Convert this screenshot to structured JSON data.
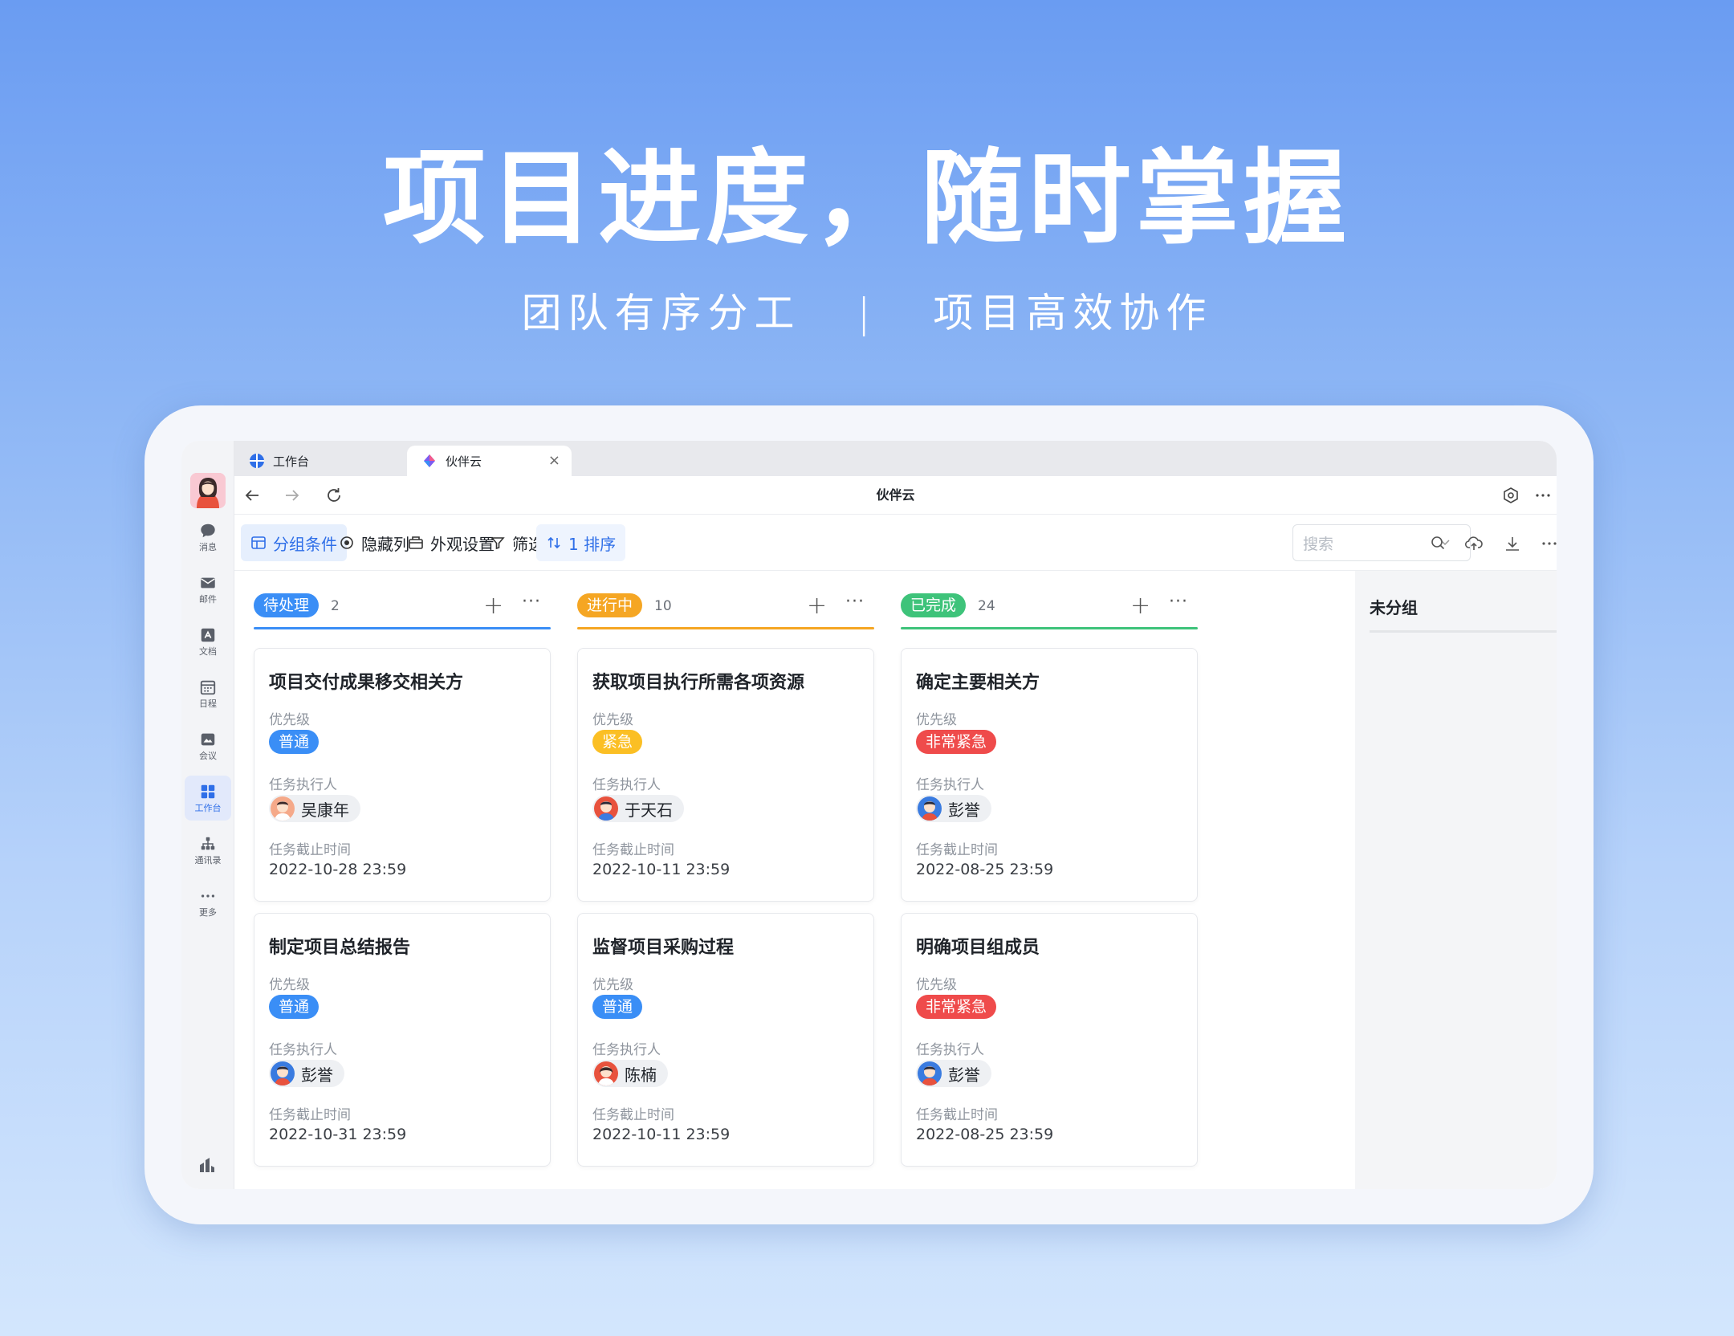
{
  "hero": {
    "title": "项目进度，随时掌握",
    "subtitle_left": "团队有序分工",
    "separator": "|",
    "subtitle_right": "项目高效协作"
  },
  "rail": {
    "items": [
      {
        "label": "消息",
        "icon": "chat-icon"
      },
      {
        "label": "邮件",
        "icon": "mail-icon"
      },
      {
        "label": "文档",
        "icon": "doc-icon"
      },
      {
        "label": "日程",
        "icon": "calendar-icon"
      },
      {
        "label": "会议",
        "icon": "meeting-icon"
      },
      {
        "label": "工作台",
        "icon": "workbench-icon",
        "active": true
      },
      {
        "label": "通讯录",
        "icon": "contacts-icon"
      },
      {
        "label": "更多",
        "icon": "more-icon"
      }
    ]
  },
  "tabs": [
    {
      "label": "工作台"
    },
    {
      "label": "伙伴云",
      "active": true
    }
  ],
  "nav": {
    "title": "伙伴云"
  },
  "toolbar": {
    "group": "分组条件",
    "hide": "隐藏列",
    "appearance": "外观设置",
    "filter": "筛选",
    "sort": "1 排序",
    "search_placeholder": "搜索"
  },
  "labels": {
    "priority": "优先级",
    "assignee": "任务执行人",
    "due": "任务截止时间",
    "plus": "+",
    "more": "···"
  },
  "colors": {
    "pending": "#3a8ef6",
    "in_progress": "#f5a623",
    "done": "#3ec37a",
    "priority_normal": "#3a8ef6",
    "priority_urgent": "#fbbf24",
    "priority_critical": "#ef4b4b"
  },
  "columns": [
    {
      "status": "待处理",
      "count": "2",
      "color": "#3a8ef6",
      "cards": [
        {
          "title": "项目交付成果移交相关方",
          "priority": "普通",
          "priority_color": "#3a8ef6",
          "assignee": "吴康年",
          "due": "2022-10-28 23:59"
        },
        {
          "title": "制定项目总结报告",
          "priority": "普通",
          "priority_color": "#3a8ef6",
          "assignee": "彭誉",
          "due": "2022-10-31 23:59"
        }
      ]
    },
    {
      "status": "进行中",
      "count": "10",
      "color": "#f5a623",
      "cards": [
        {
          "title": "获取项目执行所需各项资源",
          "priority": "紧急",
          "priority_color": "#fbbf24",
          "assignee": "于天石",
          "due": "2022-10-11 23:59"
        },
        {
          "title": "监督项目采购过程",
          "priority": "普通",
          "priority_color": "#3a8ef6",
          "assignee": "陈楠",
          "due": "2022-10-11 23:59"
        }
      ]
    },
    {
      "status": "已完成",
      "count": "24",
      "color": "#3ec37a",
      "cards": [
        {
          "title": "确定主要相关方",
          "priority": "非常紧急",
          "priority_color": "#ef4b4b",
          "assignee": "彭誉",
          "due": "2022-08-25 23:59"
        },
        {
          "title": "明确项目组成员",
          "priority": "非常紧急",
          "priority_color": "#ef4b4b",
          "assignee": "彭誉",
          "due": "2022-08-25 23:59"
        }
      ]
    }
  ],
  "ungrouped": {
    "label": "未分组"
  }
}
